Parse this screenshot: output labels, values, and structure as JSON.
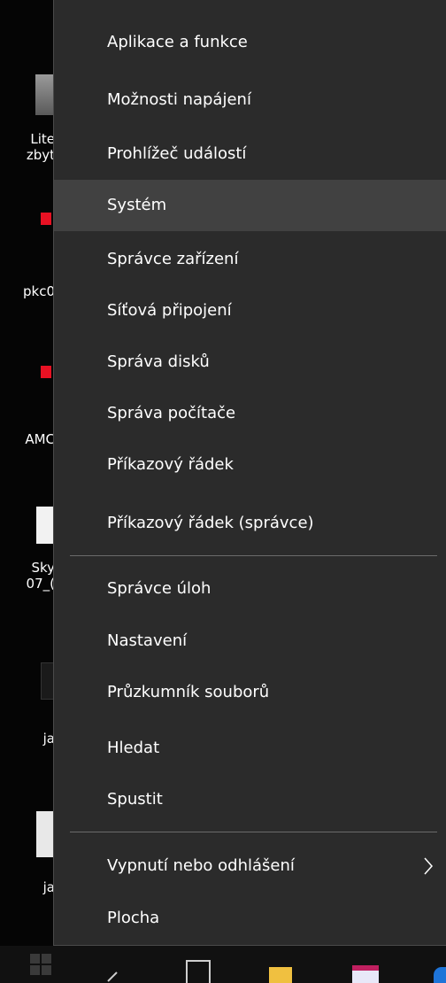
{
  "desktop": {
    "icons": [
      {
        "line1": "Lite",
        "line2": "zbyt"
      },
      {
        "line1": "pkc0",
        "line2": ""
      },
      {
        "line1": "AMC",
        "line2": ""
      },
      {
        "line1": "Sky",
        "line2": "07_("
      },
      {
        "line1": "ja",
        "line2": ""
      },
      {
        "line1": "ja",
        "line2": ""
      }
    ]
  },
  "menu": {
    "items_top": [
      "Aplikace a funkce",
      "Možnosti napájení",
      "Prohlížeč událostí",
      "Systém",
      "Správce zařízení",
      "Síťová připojení",
      "Správa disků",
      "Správa počítače",
      "Příkazový řádek",
      "Příkazový řádek (správce)"
    ],
    "items_middle": [
      "Správce úloh",
      "Nastavení",
      "Průzkumník souborů",
      "Hledat",
      "Spustit"
    ],
    "items_bottom": [
      "Vypnutí nebo odhlášení",
      "Plocha"
    ],
    "hovered_item": "Systém",
    "submenu_icon": "chevron-right-icon"
  },
  "colors": {
    "menu_bg": "#2b2b2b",
    "hover_bg": "#414141",
    "separator": "#6a6a6a",
    "text": "#ffffff"
  }
}
